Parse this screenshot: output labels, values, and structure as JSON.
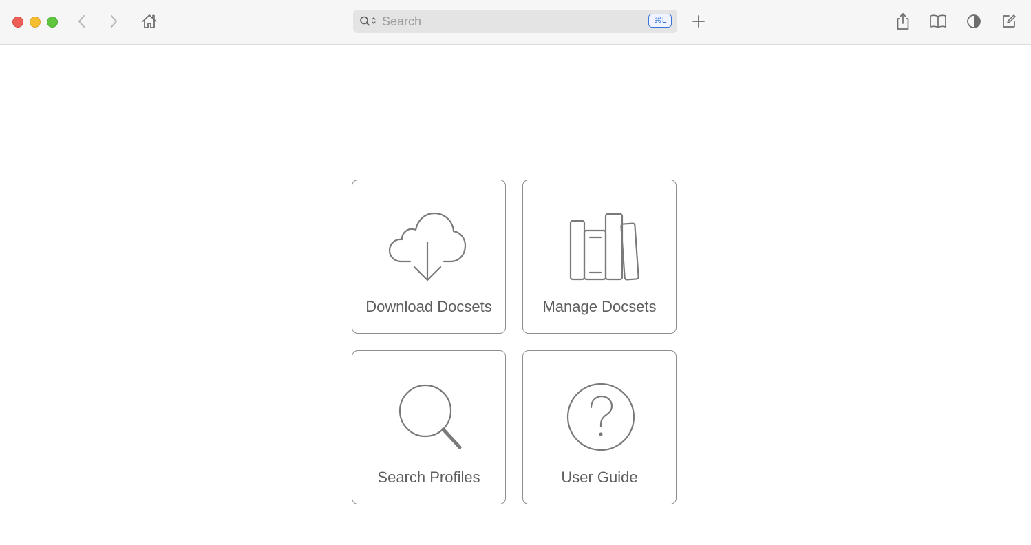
{
  "window": {
    "controls": [
      "close",
      "minimize",
      "zoom"
    ]
  },
  "toolbar": {
    "back_icon": "chevron-left-icon",
    "forward_icon": "chevron-right-icon",
    "home_icon": "house-icon",
    "search": {
      "placeholder": "Search",
      "value": "",
      "shortcut": "⌘L"
    },
    "new_tab_icon": "plus-icon",
    "share_icon": "share-icon",
    "bookmarks_icon": "book-icon",
    "appearance_icon": "contrast-icon",
    "edit_icon": "compose-icon"
  },
  "cards": {
    "download": {
      "label": "Download Docsets",
      "icon": "cloud-download-icon"
    },
    "manage": {
      "label": "Manage Docsets",
      "icon": "books-icon"
    },
    "search_profiles": {
      "label": "Search Profiles",
      "icon": "magnifier-icon"
    },
    "user_guide": {
      "label": "User Guide",
      "icon": "question-circle-icon"
    }
  },
  "colors": {
    "accent": "#3b73d9",
    "icon_gray": "#7a7a7a",
    "card_border": "#8e8e8e",
    "label_gray": "#5f5f5f"
  }
}
